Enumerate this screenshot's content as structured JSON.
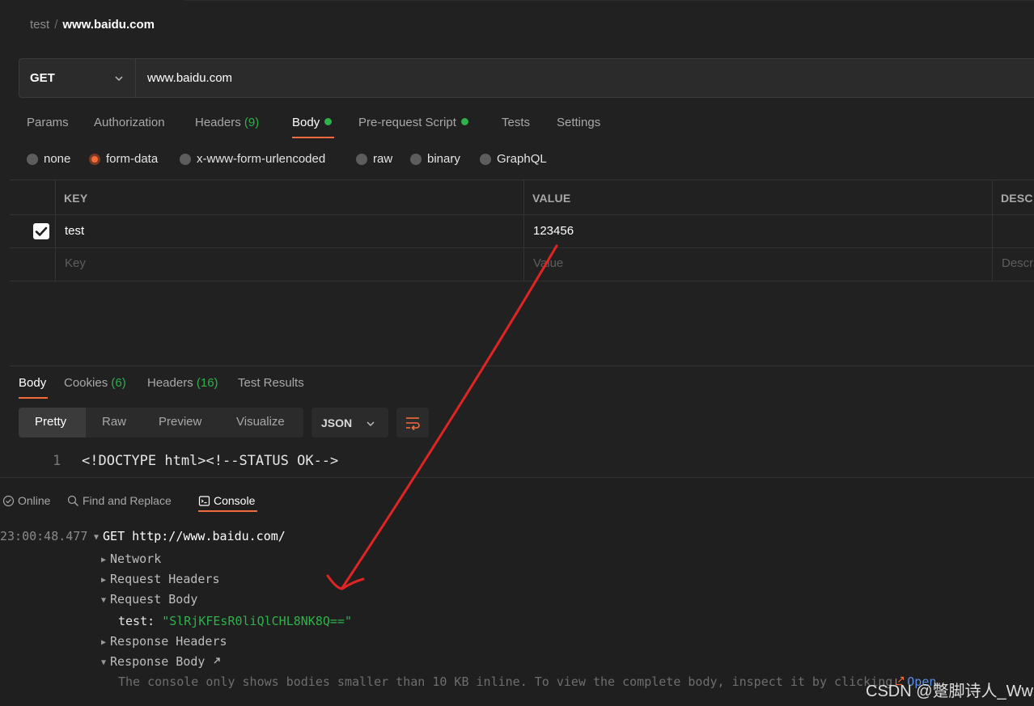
{
  "breadcrumb": {
    "collection": "test",
    "separator": "/",
    "request": "www.baidu.com"
  },
  "request": {
    "method": "GET",
    "url": "www.baidu.com"
  },
  "request_tabs": [
    {
      "label": "Params"
    },
    {
      "label": "Authorization"
    },
    {
      "label": "Headers",
      "count": "(9)"
    },
    {
      "label": "Body"
    },
    {
      "label": "Pre-request Script"
    },
    {
      "label": "Tests"
    },
    {
      "label": "Settings"
    }
  ],
  "body_types": [
    "none",
    "form-data",
    "x-www-form-urlencoded",
    "raw",
    "binary",
    "GraphQL"
  ],
  "body_type_selected": "form-data",
  "table": {
    "headers": [
      "KEY",
      "VALUE",
      "DESC"
    ],
    "rows": [
      {
        "checked": true,
        "key": "test",
        "value": "123456"
      }
    ],
    "placeholders": {
      "key": "Key",
      "value": "Value",
      "description": "Descr"
    }
  },
  "response_tabs": [
    {
      "label": "Body"
    },
    {
      "label": "Cookies",
      "count": "(6)"
    },
    {
      "label": "Headers",
      "count": "(16)"
    },
    {
      "label": "Test Results"
    }
  ],
  "view_modes": [
    "Pretty",
    "Raw",
    "Preview",
    "Visualize"
  ],
  "format": "JSON",
  "response_body": {
    "line_number": "1",
    "line": "<!DOCTYPE html><!--STATUS OK-->"
  },
  "statusbar": {
    "online": "Online",
    "find_replace": "Find and Replace",
    "console": "Console"
  },
  "console": {
    "timestamp": "23:00:48.477",
    "request_line": "GET http://www.baidu.com/",
    "sections": [
      "Network",
      "Request Headers",
      "Request Body",
      "Response Headers",
      "Response Body"
    ],
    "body_key": "test:",
    "body_value": "\"SlRjKFEsR0liQlCHL8NK8Q==\"",
    "note": "The console only shows bodies smaller than 10 KB inline. To view the complete body, inspect it by clicking",
    "open_link": "Open"
  },
  "watermark": "CSDN @蹩脚诗人_Ww",
  "colors": {
    "accent": "#f26b3a",
    "green": "#2fb14b",
    "background": "#212121",
    "arrow": "#e02424"
  }
}
